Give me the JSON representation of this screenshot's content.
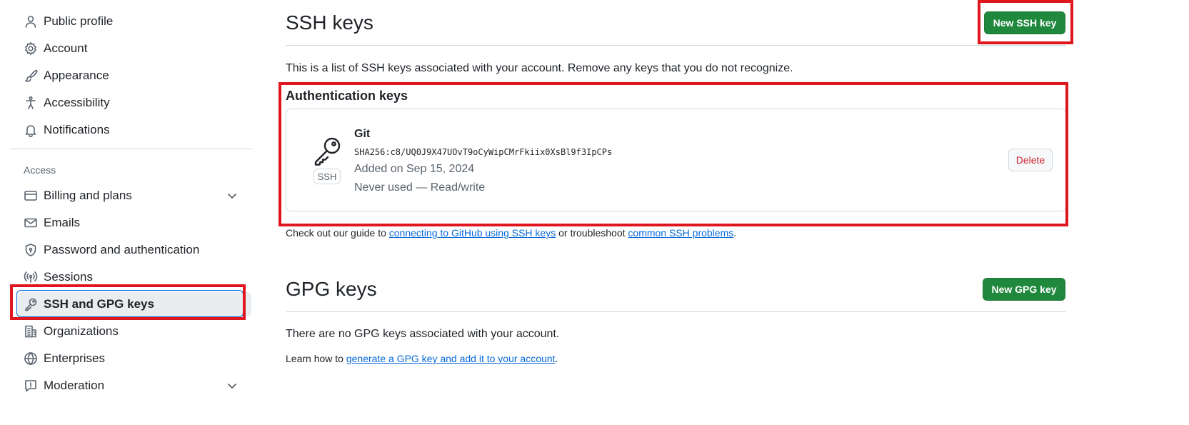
{
  "sidebar": {
    "items_top": [
      {
        "label": "Public profile",
        "icon": "person-icon"
      },
      {
        "label": "Account",
        "icon": "gear-icon"
      },
      {
        "label": "Appearance",
        "icon": "paintbrush-icon"
      },
      {
        "label": "Accessibility",
        "icon": "accessibility-icon"
      },
      {
        "label": "Notifications",
        "icon": "bell-icon"
      }
    ],
    "section_access": "Access",
    "items_access": [
      {
        "label": "Billing and plans",
        "icon": "credit-card-icon",
        "expandable": true
      },
      {
        "label": "Emails",
        "icon": "mail-icon"
      },
      {
        "label": "Password and authentication",
        "icon": "shield-lock-icon"
      },
      {
        "label": "Sessions",
        "icon": "broadcast-icon"
      },
      {
        "label": "SSH and GPG keys",
        "icon": "key-icon",
        "active": true
      },
      {
        "label": "Organizations",
        "icon": "organization-icon"
      },
      {
        "label": "Enterprises",
        "icon": "globe-icon"
      },
      {
        "label": "Moderation",
        "icon": "report-icon",
        "expandable": true
      }
    ]
  },
  "ssh": {
    "title": "SSH keys",
    "new_button": "New SSH key",
    "description": "This is a list of SSH keys associated with your account. Remove any keys that you do not recognize.",
    "auth_heading": "Authentication keys",
    "key": {
      "type_label": "SSH",
      "title": "Git",
      "fingerprint": "SHA256:c8/UQ0J9X47UOvT9oCyWipCMrFkiix0XsBl9f3IpCPs",
      "added": "Added on Sep 15, 2024",
      "usage": "Never used — Read/write",
      "delete_label": "Delete"
    },
    "guide": {
      "prefix": "Check out our guide to ",
      "link1": "connecting to GitHub using SSH keys",
      "middle": " or troubleshoot ",
      "link2": "common SSH problems",
      "suffix": "."
    }
  },
  "gpg": {
    "title": "GPG keys",
    "new_button": "New GPG key",
    "empty_text": "There are no GPG keys associated with your account.",
    "learn": {
      "prefix": "Learn how to ",
      "link": "generate a GPG key and add it to your account",
      "suffix": "."
    }
  },
  "colors": {
    "primary_button": "#1f883d",
    "link": "#0969da",
    "danger": "#d1242f",
    "highlight_box": "#e0161e"
  }
}
